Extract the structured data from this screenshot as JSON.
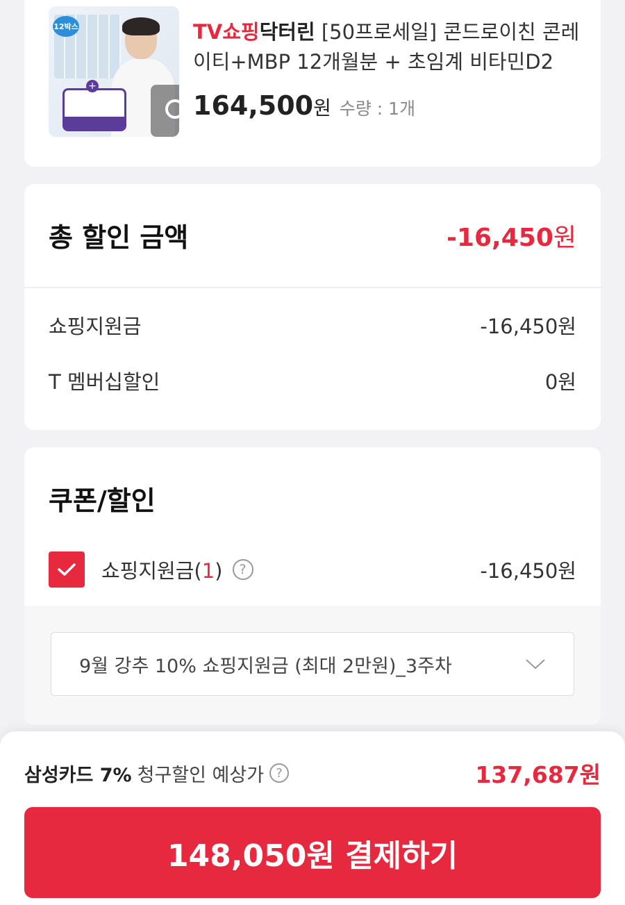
{
  "product": {
    "brand_red": "TV쇼핑",
    "brand_bold": "닥터린",
    "name_rest": " [50프로세일] 콘드로이친 콘레이티+MBP 12개월분 + 초임계 비타민D2",
    "price": "164,500",
    "price_unit": "원",
    "quantity": "수량 : 1개",
    "thumb_badge": "12박스"
  },
  "discount": {
    "title": "총 할인 금액",
    "total_amount": "-16,450",
    "unit": "원",
    "rows": [
      {
        "label": "쇼핑지원금",
        "value": "-16,450원"
      },
      {
        "label": "T 멤버십할인",
        "value": "0원"
      }
    ]
  },
  "coupon": {
    "title": "쿠폰/할인",
    "item_label": "쇼핑지원금(",
    "item_count": "1",
    "item_close": ")",
    "item_value": "-16,450원",
    "selected_coupon": "9월 강추 10% 쇼핑지원금 (최대 2만원)_3주차"
  },
  "footer": {
    "card_name": "삼성카드 7%",
    "est_text": "청구할인 예상가",
    "est_price": "137,687원",
    "pay_button": "148,050원 결제하기"
  },
  "colors": {
    "accent": "#e6293f",
    "background": "#f2f2f4"
  }
}
